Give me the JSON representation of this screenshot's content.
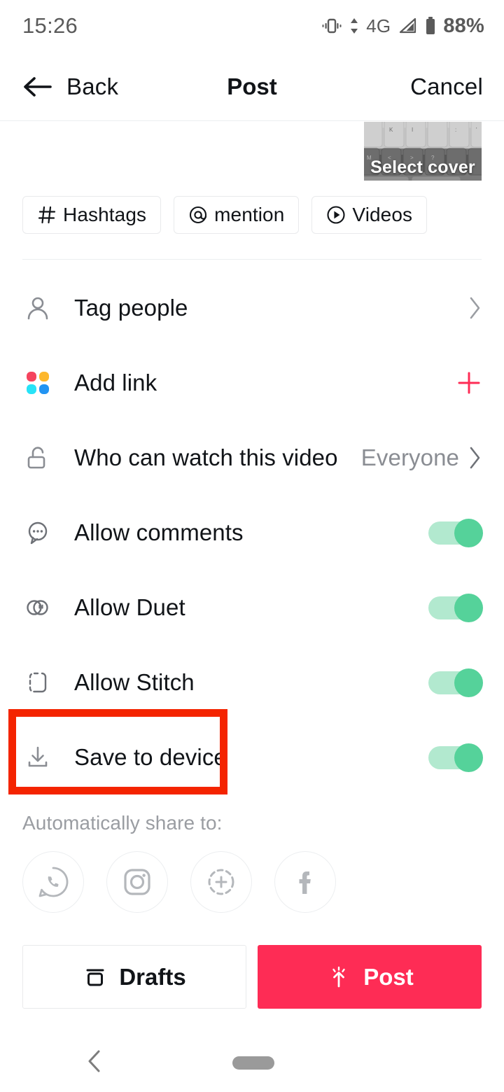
{
  "status_bar": {
    "time": "15:26",
    "network_type": "4G",
    "battery_percent": "88%",
    "icons": [
      "vibrate-icon",
      "data-transfer-icon",
      "signal-icon",
      "battery-icon"
    ]
  },
  "header": {
    "back_label": "Back",
    "title": "Post",
    "cancel_label": "Cancel",
    "back_icon": "arrow-left-icon"
  },
  "caption": {
    "value": "",
    "placeholder": ""
  },
  "cover": {
    "label": "Select cover",
    "thumbnail_description": "grayscale keyboard keys"
  },
  "chips": [
    {
      "glyph": "#",
      "label": "Hashtags",
      "icon": "hashtag-icon"
    },
    {
      "glyph": "@",
      "label": "mention",
      "icon": "at-mention-icon"
    },
    {
      "glyph": "▶",
      "label": "Videos",
      "icon": "play-circle-icon"
    }
  ],
  "rows": [
    {
      "label": "Tag people",
      "icon": "person-icon",
      "control": "chevron",
      "value": ""
    },
    {
      "label": "Add link",
      "icon": "link-dots-icon",
      "control": "plus",
      "value": ""
    },
    {
      "label": "Who can watch this video",
      "icon": "unlock-icon",
      "control": "chevron",
      "value": "Everyone"
    },
    {
      "label": "Allow comments",
      "icon": "comment-icon",
      "control": "toggle",
      "value": "on"
    },
    {
      "label": "Allow Duet",
      "icon": "duet-icon",
      "control": "toggle",
      "value": "on"
    },
    {
      "label": "Allow Stitch",
      "icon": "stitch-icon",
      "control": "toggle",
      "value": "on"
    },
    {
      "label": "Save to device",
      "icon": "download-icon",
      "control": "toggle",
      "value": "on"
    }
  ],
  "share": {
    "label": "Automatically share to:",
    "targets": [
      {
        "name": "whatsapp-icon"
      },
      {
        "name": "instagram-icon"
      },
      {
        "name": "instagram-story-icon"
      },
      {
        "name": "facebook-icon"
      }
    ]
  },
  "actions": {
    "drafts_label": "Drafts",
    "drafts_icon": "drafts-icon",
    "post_label": "Post",
    "post_icon": "upload-sparkle-icon"
  },
  "nav_bar": {
    "back_icon": "chevron-left-icon",
    "home_pill": "home-pill"
  },
  "annotation": {
    "target": "Save to device",
    "color": "#F42400"
  },
  "colors": {
    "brand_red": "#FE2C55",
    "toggle_track": "#B2E9CF",
    "toggle_knob": "#55D29A",
    "text_primary": "#111418",
    "text_muted": "#8A8D93",
    "annotation": "#F42400"
  }
}
